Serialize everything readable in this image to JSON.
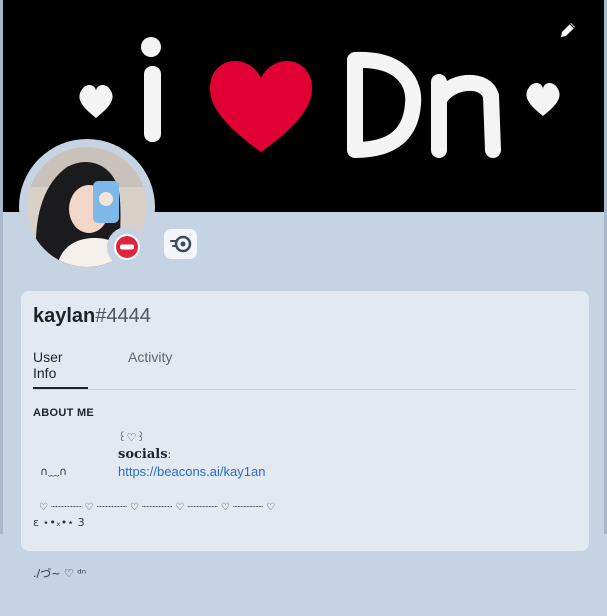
{
  "banner": {
    "text": "i Dn",
    "heart_color": "#e00034",
    "edit_icon": "pencil-icon"
  },
  "profile": {
    "username": "kaylan",
    "discriminator": "#4444",
    "status": "do-not-disturb",
    "status_color": "#e0243d",
    "badge_icon": "nitro-boost-icon"
  },
  "tabs": [
    {
      "label": "User Info",
      "active": true
    },
    {
      "label": "Activity",
      "active": false
    }
  ],
  "about": {
    "heading": "ABOUT ME",
    "bio_left_line1": "  ∩﹏∩",
    "bio_left_line2": "ε ⋆•ₓ•⋆ 3",
    "bio_left_line3": "./づ~ ♡ ᵈⁿ",
    "bio_right_line1": "꒰♡꒱",
    "socials_label": "socials",
    "socials_colon": ":",
    "link": "https://beacons.ai/kay1an",
    "divider": "♡ ┈┈┈┈┈ ♡ ┈┈┈┈┈ ♡ ┈┈┈┈┈ ♡ ┈┈┈┈┈ ♡ ┈┈┈┈┈ ♡"
  }
}
